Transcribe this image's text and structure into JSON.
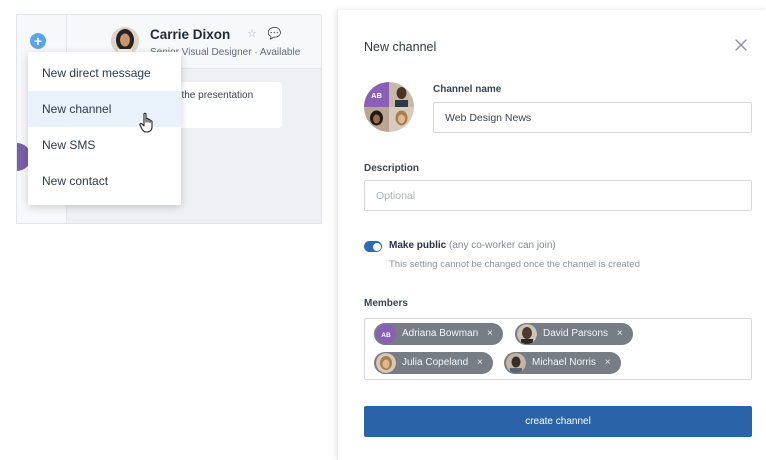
{
  "chat": {
    "contact_name": "Carrie Dixon",
    "contact_status": "Senior Visual Designer · Available",
    "contact_icons": "☆ 💬",
    "message_preview": "for the presentation"
  },
  "menu": {
    "items": [
      {
        "label": "New direct message"
      },
      {
        "label": "New channel"
      },
      {
        "label": "New SMS"
      },
      {
        "label": "New contact"
      }
    ],
    "active_index": 1
  },
  "modal": {
    "title": "New channel",
    "channel_name_label": "Channel name",
    "channel_name_value": "Web Design News",
    "avatar_initials": "AB",
    "description_label": "Description",
    "description_placeholder": "Optional",
    "public_label": "Make public",
    "public_hint": "(any co-worker can join)",
    "public_note": "This setting cannot be changed once the channel is created",
    "public_enabled": true,
    "members_label": "Members",
    "members": [
      {
        "name": "Adriana Bowman",
        "initials": "AB",
        "avatar_color": "#8a5fb6"
      },
      {
        "name": "David Parsons",
        "initials": "",
        "avatar_color": "#4a3a30"
      },
      {
        "name": "Julia Copeland",
        "initials": "",
        "avatar_color": "#b78d5c"
      },
      {
        "name": "Michael Norris",
        "initials": "",
        "avatar_color": "#3a2c26"
      }
    ],
    "remove_glyph": "×",
    "create_button_label": "create channel"
  },
  "colors": {
    "accent": "#2b63a8",
    "toggle": "#2b6cb8",
    "plus_button": "#5aa5e6",
    "chip": "#777d85"
  }
}
